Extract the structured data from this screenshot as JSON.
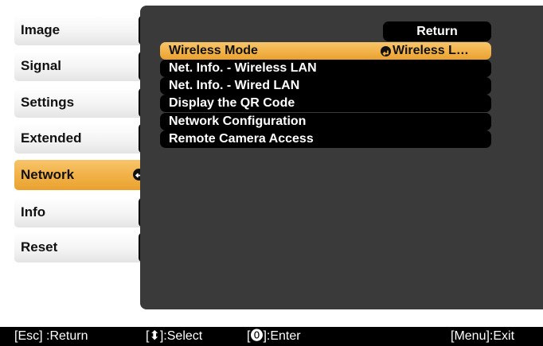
{
  "sidebar": {
    "items": [
      {
        "label": "Image"
      },
      {
        "label": "Signal"
      },
      {
        "label": "Settings"
      },
      {
        "label": "Extended"
      },
      {
        "label": "Network",
        "active": true
      },
      {
        "label": "Info"
      },
      {
        "label": "Reset"
      }
    ],
    "active_icon": "enter-icon"
  },
  "panel": {
    "return_label": "Return",
    "rows": [
      {
        "label": "Wireless Mode",
        "value": "Wireless L…",
        "value_icon": "enter-icon",
        "selected": true
      },
      {
        "label": "Net. Info. - Wireless LAN"
      },
      {
        "label": "Net. Info. - Wired LAN"
      },
      {
        "label": "Display the QR Code"
      },
      {
        "label": "Network Configuration"
      },
      {
        "label": "Remote Camera Access"
      }
    ]
  },
  "footer": {
    "esc": "[Esc] :Return",
    "select": "[⬍]:Select",
    "enter": "[⓿]:Enter",
    "menu": "[Menu]:Exit"
  },
  "colors": {
    "highlight": "#f1b045",
    "panel_bg": "#3a3a3a",
    "row_bg": "#000000",
    "footer_bg": "#000000"
  }
}
